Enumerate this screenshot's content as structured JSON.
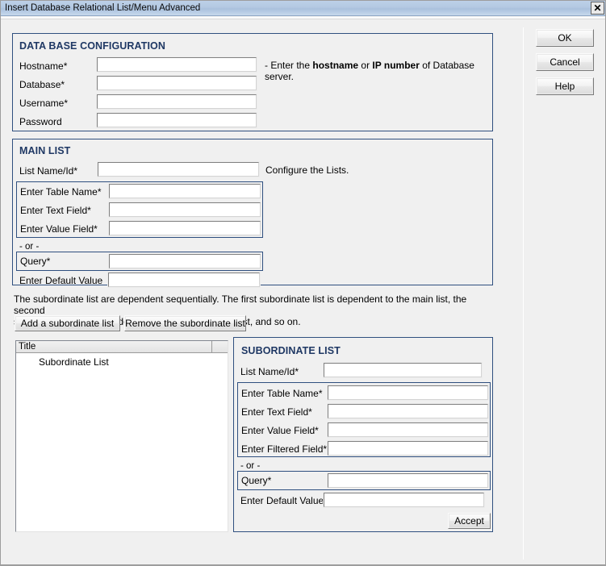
{
  "window": {
    "title": "Insert Database Relational List/Menu Advanced",
    "close_label": "✕"
  },
  "action_buttons": [
    {
      "label": "OK",
      "name": "ok-button"
    },
    {
      "label": "Cancel",
      "name": "cancel-button"
    },
    {
      "label": "Help",
      "name": "help-button"
    }
  ],
  "db_config": {
    "title": "DATA BASE CONFIGURATION",
    "fields": [
      {
        "label": "Hostname*",
        "value": "",
        "name": "hostname-input"
      },
      {
        "label": "Database*",
        "value": "",
        "name": "database-input"
      },
      {
        "label": "Username*",
        "value": "",
        "name": "username-input"
      },
      {
        "label": "Password",
        "value": "",
        "name": "password-input"
      }
    ],
    "hint_prefix": "- Enter the ",
    "hint_bold1": "hostname",
    "hint_mid": " or ",
    "hint_bold2": "IP number",
    "hint_suffix": " of Database server."
  },
  "main_list": {
    "title": "MAIN LIST",
    "list_name_label": "List Name/Id*",
    "list_name_value": "",
    "hint": "Configure the Lists.",
    "table_fields": [
      {
        "label": "Enter Table Name*",
        "value": "",
        "name": "main-table-name-input"
      },
      {
        "label": "Enter Text Field*",
        "value": "",
        "name": "main-text-field-input"
      },
      {
        "label": "Enter Value Field*",
        "value": "",
        "name": "main-value-field-input"
      }
    ],
    "or_label": "- or -",
    "query_label": "Query*",
    "query_value": "",
    "default_label": "Enter Default Value",
    "default_value": ""
  },
  "subordinate_info": {
    "line1": "The subordinate list are dependent sequentially. The first subordinate list is dependent to the main list, the second",
    "line2": "subordinate list is dependent to the first subordinate list, and so on.",
    "add_button": "Add a subordinate list",
    "remove_button": "Remove the subordinate list"
  },
  "tree": {
    "column_header": "Title",
    "items": [
      "Subordinate List"
    ]
  },
  "subordinate_list": {
    "title": "SUBORDINATE LIST",
    "list_name_label": "List Name/Id*",
    "list_name_value": "",
    "table_fields": [
      {
        "label": "Enter Table Name*",
        "value": "",
        "name": "sub-table-name-input"
      },
      {
        "label": "Enter Text Field*",
        "value": "",
        "name": "sub-text-field-input"
      },
      {
        "label": "Enter Value Field*",
        "value": "",
        "name": "sub-value-field-input"
      },
      {
        "label": "Enter Filtered Field*",
        "value": "",
        "name": "sub-filtered-field-input"
      }
    ],
    "or_label": "- or -",
    "query_label": "Query*",
    "query_value": "",
    "default_label": "Enter Default Value",
    "default_value": "",
    "accept_button": "Accept"
  },
  "colors": {
    "group_border": "#2f4f7f",
    "group_title": "#1f3864",
    "titlebar": "#b3c8e2",
    "background": "#f0f0f0"
  }
}
